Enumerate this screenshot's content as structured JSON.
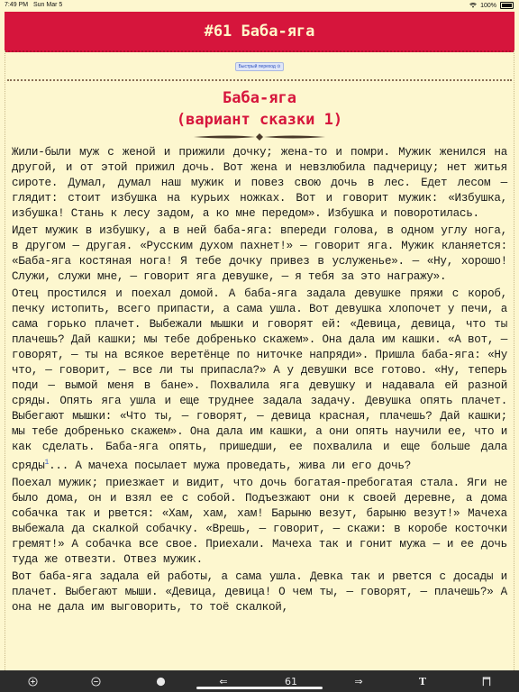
{
  "status": {
    "time": "7:49 PM",
    "date": "Sun Mar 5",
    "battery": "100%"
  },
  "header": {
    "title": "#61 Баба-яга"
  },
  "quick_jump": {
    "label": "Быстрый переход ⊙"
  },
  "story": {
    "title_line1": "Баба-яга",
    "title_line2": "(вариант сказки 1)",
    "paragraphs": [
      "Жили-были муж с женой и прижили дочку; жена-то и помри. Мужик женился на другой, и от этой прижил дочь. Вот жена и невзлюбила падчерицу; нет житья сироте. Думал, думал наш мужик и повез свою дочь в лес. Едет лесом — глядит: стоит избушка на курьих ножках. Вот и говорит мужик: «Избушка, избушка! Стань к лесу задом, а ко мне передом». Избушка и поворотилась.",
      "Идет мужик в избушку, а в ней баба-яга: впереди голова, в одном углу нога, в другом — другая. «Русским духом пахнет!» — говорит яга. Мужик кланяется: «Баба-яга костяная нога! Я тебе дочку привез в услуженье». — «Ну, хорошо! Служи, служи мне, — говорит яга девушке, — я тебя за это награжу».",
      "Отец простился и поехал домой. А баба-яга задала девушке пряжи с короб, печку истопить, всего припасти, а сама ушла. Вот девушка хлопочет у печи, а сама горько плачет. Выбежали мышки и говорят ей: «Девица, девица, что ты плачешь? Дай кашки; мы тебе добренько скажем». Она дала им кашки. «А вот, — говорят, — ты на всякое веретёнце по ниточке напряди». Пришла баба-яга: «Ну что, — говорит, — все ли ты припасла?» А у девушки все готово. «Ну, теперь поди — вымой меня в бане». Похвалила яга девушку и надавала ей разной сряды. Опять яга ушла и еще труднее задала задачу. Девушка опять плачет. Выбегают мышки: «Что ты, — говорят, — девица красная, плачешь? Дай кашки; мы тебе добренько скажем». Она дала им кашки, а они опять научили ее, что и как сделать. Баба-яга опять, пришедши, ее похвалила и еще больше дала сряды",
      "... А мачеха посылает мужа проведать, жива ли его дочь?",
      "Поехал мужик; приезжает и видит, что дочь богатая-пребогатая стала. Яги не было дома, он и взял ее с собой. Подъезжают они к своей деревне, а дома собачка так и рвется: «Хам, хам, хам! Барыню везут, барыню везут!» Мачеха выбежала да скалкой собачку. «Врешь, — говорит, — скажи: в коробе косточки гремят!» А собачка все свое. Приехали. Мачеха так и гонит мужа — и ее дочь туда же отвезти. Отвез мужик.",
      "Вот баба-яга задала ей работы, а сама ушла. Девка так и рвется с досады и плачет. Выбегают мыши. «Девица, девица! О чем ты, — говорят, — плачешь?» А она не дала им выговорить, то тоё скалкой,"
    ],
    "footnote_mark": "1"
  },
  "toolbar": {
    "page_number": "61",
    "icons": [
      "plus-icon",
      "minus-icon",
      "circle-icon",
      "arrow-left-icon",
      "arrow-right-icon",
      "text-icon",
      "bookmark-icon"
    ]
  }
}
